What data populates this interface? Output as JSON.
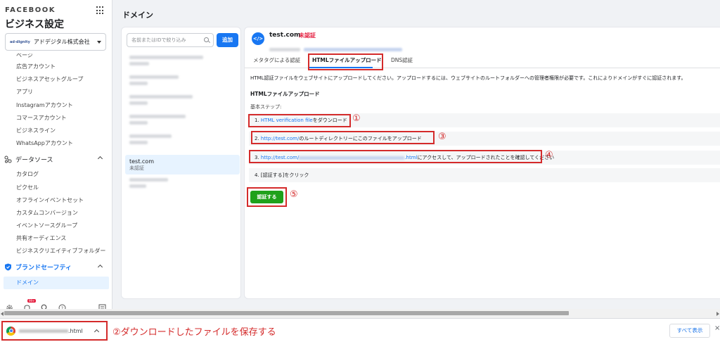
{
  "sidebar": {
    "brand": "FACEBOOK",
    "title": "ビジネス設定",
    "account": {
      "logo": "ad-dignity",
      "name": "アドデジタル株式会社"
    },
    "top_items": [
      "ページ",
      "広告アカウント",
      "ビジネスアセットグループ",
      "アプリ",
      "Instagramアカウント",
      "コマースアカウント",
      "ビジネスライン",
      "WhatsAppアカウント"
    ],
    "data_sources": {
      "label": "データソース",
      "items": [
        "カタログ",
        "ピクセル",
        "オフラインイベントセット",
        "カスタムコンバージョン",
        "イベントソースグループ",
        "共有オーディエンス",
        "ビジネスクリエイティブフォルダー"
      ]
    },
    "brand_safety": {
      "label": "ブランドセーフティ",
      "items": [
        "ドメイン"
      ]
    },
    "notif_count": "99+"
  },
  "main": {
    "page_title": "ドメイン",
    "search_placeholder": "名前またはIDで絞り込み",
    "add_label": "追加",
    "selected_domain": {
      "name": "test.com",
      "status": "未認証"
    }
  },
  "detail": {
    "icon": "</>",
    "name": "test.com",
    "status": "未認証",
    "tabs": [
      "メタタグによる認証",
      "HTMLファイルアップロード",
      "DNS認証"
    ],
    "description": "HTML認証ファイルをウェブサイトにアップロードしてください。アップロードするには、ウェブサイトのルートフォルダーへの管理者権限が必要です。これによりドメインがすぐに認証されます。",
    "subtitle": "HTMLファイルアップロード",
    "steps_label": "基本ステップ:",
    "step1": {
      "prefix": "1. ",
      "link": "HTML verification file",
      "suffix": "をダウンロード"
    },
    "step2": {
      "prefix": "2. ",
      "link": "http://test.com/",
      "suffix": "のルートディレクトリーにこのファイルをアップロード"
    },
    "step3": {
      "prefix": "3. ",
      "link": "http://test.com/",
      "link_end": ".html",
      "suffix": "にアクセスして、アップロードされたことを確認してください"
    },
    "step4": "4. [認証する]をクリック",
    "verify_label": "認証する"
  },
  "annotations": {
    "a1": "①",
    "a2": "②ダウンロードしたファイルを保存する",
    "a3": "③",
    "a4": "④",
    "a5": "⑤"
  },
  "download": {
    "file_ext": ".html",
    "show_all": "すべて表示",
    "close": "×"
  },
  "colors": {
    "accent": "#1877f2",
    "annotation": "#d42b2b",
    "verify": "#1fa11b",
    "unverified": "#e41e3f"
  }
}
